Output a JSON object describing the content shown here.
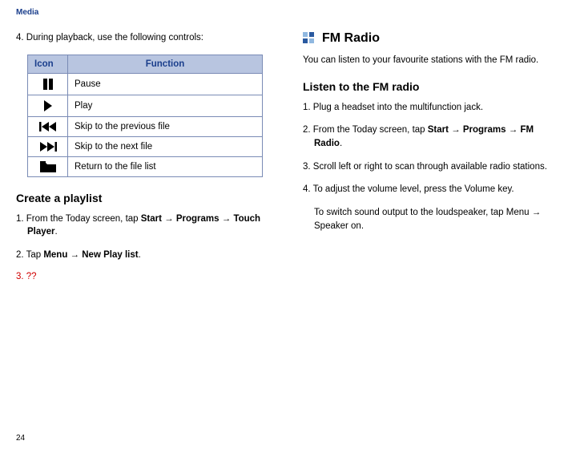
{
  "header": {
    "page_category": "Media"
  },
  "left": {
    "step4": "4. During playback, use the following controls:",
    "table": {
      "head_icon": "Icon",
      "head_func": "Function",
      "rows": [
        {
          "icon": "pause-icon",
          "func": "Pause"
        },
        {
          "icon": "play-icon",
          "func": "Play"
        },
        {
          "icon": "skip-prev-icon",
          "func": "Skip to the previous file"
        },
        {
          "icon": "skip-next-icon",
          "func": "Skip to the next file"
        },
        {
          "icon": "folder-icon",
          "func": "Return to the file list"
        }
      ]
    },
    "h3_create": "Create a playlist",
    "pl_step1_a": "1. From the Today screen, tap ",
    "pl_step1_b1": "Start",
    "pl_step1_arr1": " → ",
    "pl_step1_b2": "Programs",
    "pl_step1_arr2": " → ",
    "pl_step1_b3": "Touch Player",
    "pl_step1_dot": ".",
    "pl_step2_a": "2. Tap ",
    "pl_step2_b1": "Menu",
    "pl_step2_arr1": " → ",
    "pl_step2_b2": "New Play list",
    "pl_step2_dot": ".",
    "pl_step3": "3. ??"
  },
  "right": {
    "h2_fm": "FM Radio",
    "intro": "You can listen to your favourite stations with the FM radio.",
    "h3_listen": "Listen to the FM radio",
    "fm1": "1. Plug a headset into the multifunction jack.",
    "fm2_a": "2. From the Today screen, tap ",
    "fm2_b1": "Start",
    "fm2_arr1": " → ",
    "fm2_b2": "Programs",
    "fm2_arr2": " → ",
    "fm2_b3": "FM Radio",
    "fm2_dot": ".",
    "fm3": "3. Scroll left or right to scan through available radio stations.",
    "fm4": "4. To adjust the volume level, press the Volume key.",
    "fm4b_a": "To switch sound output to the loudspeaker, tap ",
    "fm4b_b1": "Menu",
    "fm4b_arr1": " → ",
    "fm4b_b2": "Speaker on",
    "fm4b_dot": "."
  },
  "page_number": "24"
}
